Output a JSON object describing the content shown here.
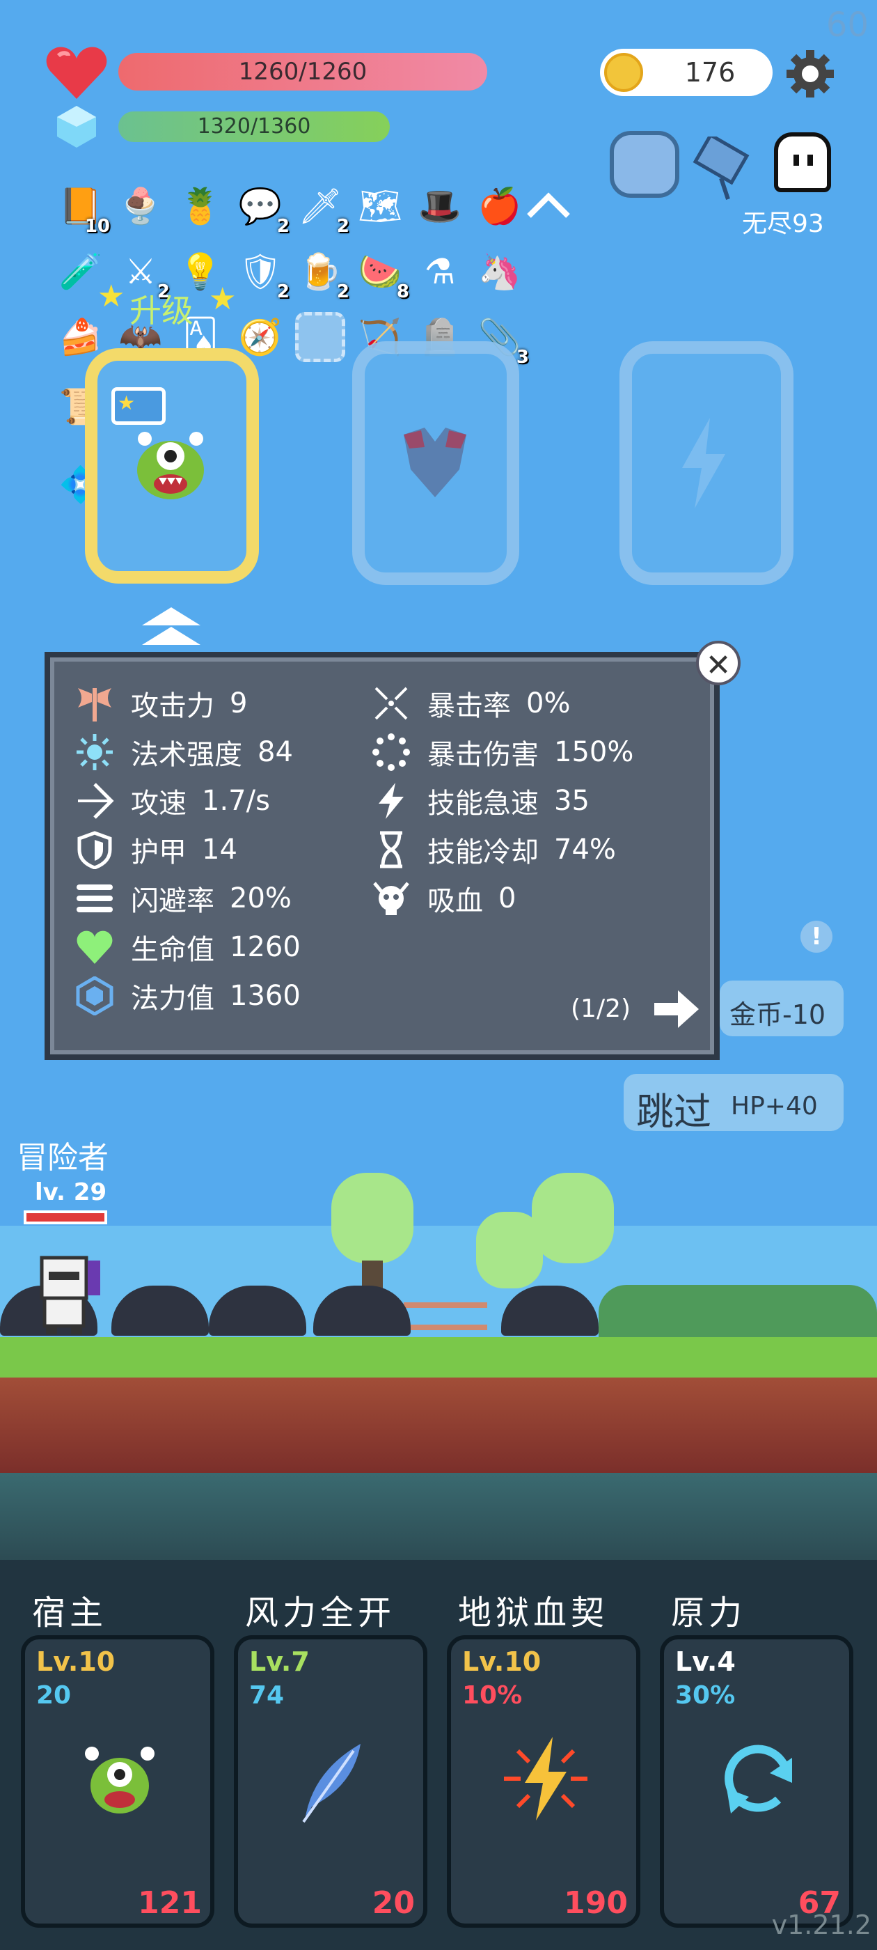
{
  "hud": {
    "fps": "60",
    "hp": "1260/1260",
    "mp": "1320/1360",
    "gold": "176",
    "mode_label": "无尽93"
  },
  "inventory": {
    "items": [
      {
        "icon": "spellbook-icon",
        "count": "10"
      },
      {
        "icon": "ice-cream-icon",
        "count": ""
      },
      {
        "icon": "pineapple-icon",
        "count": ""
      },
      {
        "icon": "speech-bubble-icon",
        "count": "2"
      },
      {
        "icon": "dagger-icon",
        "count": "2"
      },
      {
        "icon": "treasure-map-icon",
        "count": ""
      },
      {
        "icon": "wizard-hat-icon",
        "count": ""
      },
      {
        "icon": "apple-icon",
        "count": ""
      },
      {
        "icon": "potion-icon",
        "count": ""
      },
      {
        "icon": "sword-icon",
        "count": "2"
      },
      {
        "icon": "light-bulb-icon",
        "count": ""
      },
      {
        "icon": "round-shield-icon",
        "count": "2"
      },
      {
        "icon": "beer-mug-icon",
        "count": "2"
      },
      {
        "icon": "watermelon-icon",
        "count": "8"
      },
      {
        "icon": "mortar-pestle-icon",
        "count": ""
      },
      {
        "icon": "unicorn-icon",
        "count": ""
      },
      {
        "icon": "cake-icon",
        "count": ""
      },
      {
        "icon": "bat-icon",
        "count": ""
      },
      {
        "icon": "playing-cards-icon",
        "count": ""
      },
      {
        "icon": "compass-icon",
        "count": ""
      },
      {
        "icon": "empty-slot-icon",
        "count": ""
      },
      {
        "icon": "crossbow-icon",
        "count": ""
      },
      {
        "icon": "tombstone-icon",
        "count": ""
      },
      {
        "icon": "safety-pin-icon",
        "count": "3"
      },
      {
        "icon": "scroll-icon",
        "count": ""
      },
      {
        "icon": "id-card-icon",
        "count": ""
      },
      {
        "icon": "crystal-lamp-icon",
        "count": ""
      }
    ],
    "upgrade_label": "升级"
  },
  "stats": {
    "left": [
      {
        "label": "攻击力",
        "value": "9"
      },
      {
        "label": "法术强度",
        "value": "84"
      },
      {
        "label": "攻速",
        "value": "1.7/s"
      },
      {
        "label": "护甲",
        "value": "14"
      },
      {
        "label": "闪避率",
        "value": "20%"
      },
      {
        "label": "生命值",
        "value": "1260"
      },
      {
        "label": "法力值",
        "value": "1360"
      }
    ],
    "right": [
      {
        "label": "暴击率",
        "value": "0%"
      },
      {
        "label": "暴击伤害",
        "value": "150%"
      },
      {
        "label": "技能急速",
        "value": "35"
      },
      {
        "label": "技能冷却",
        "value": "74%"
      },
      {
        "label": "吸血",
        "value": "0"
      }
    ],
    "page": "(1/2)",
    "close_symbol": "✕"
  },
  "actions": {
    "gold_cost": "金币-10",
    "skip": "跳过",
    "skip_bonus": "HP+40",
    "alert": "!"
  },
  "player": {
    "name": "冒险者",
    "level": "lv. 29"
  },
  "skills": [
    {
      "name": "宿主",
      "level": "Lv.10",
      "sub": "20",
      "cost": "121",
      "level_color": "#f2c34a",
      "sub_color": "#55c8f0"
    },
    {
      "name": "风力全开",
      "level": "Lv.7",
      "sub": "74",
      "cost": "20",
      "level_color": "#a8e060",
      "sub_color": "#55c8f0"
    },
    {
      "name": "地狱血契",
      "level": "Lv.10",
      "sub": "10%",
      "cost": "190",
      "level_color": "#f2c34a",
      "sub_color": "#ff4e5e"
    },
    {
      "name": "原力",
      "level": "Lv.4",
      "sub": "30%",
      "cost": "67",
      "level_color": "#ffffff",
      "sub_color": "#55c8f0"
    }
  ],
  "version": "v1.21.2"
}
